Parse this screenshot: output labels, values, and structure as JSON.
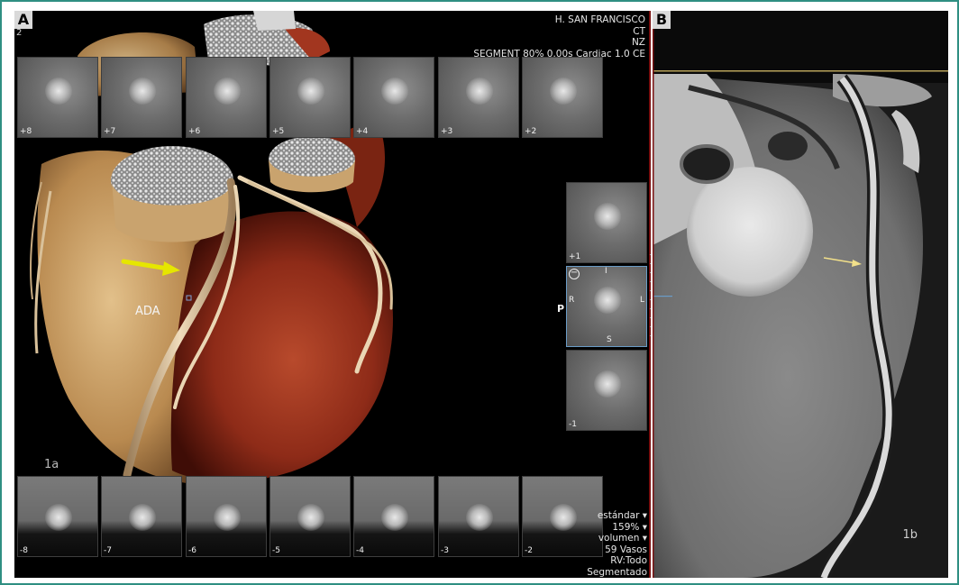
{
  "figure": {
    "panel_a_letter": "A",
    "panel_b_letter": "B",
    "corner_number": "2"
  },
  "header_info": {
    "line1": "H. SAN FRANCISCO",
    "line2": "CT",
    "line3": "NZ",
    "line4": "SEGMENT 80% 0.00s Cardiac 1.0 CE"
  },
  "footer_info": {
    "line1": "estándar ▾",
    "line2": "159% ▾",
    "line3": "volumen ▾",
    "line4": "59 Vasos",
    "line5": "RV:Todo",
    "line6": "Segmentado"
  },
  "labels": {
    "ada": "ADA",
    "sub_a": "1a",
    "sub_b": "1b",
    "p_marker": "P",
    "sel_top": "I",
    "sel_right": "L",
    "sel_left": "R",
    "sel_bottom": "S",
    "sel_icon": "−"
  },
  "top_thumbs": [
    "+8",
    "+7",
    "+6",
    "+5",
    "+4",
    "+3",
    "+2"
  ],
  "side_thumbs": [
    "+1",
    "",
    "-1"
  ],
  "bottom_thumbs": [
    "-8",
    "-7",
    "-6",
    "-5",
    "-4",
    "-3",
    "-2"
  ],
  "colors": {
    "frame": "#2f8f82",
    "arrow_a": "#e6e600",
    "arrow_b": "#f2e08a",
    "myocardium": "#a2361f"
  }
}
